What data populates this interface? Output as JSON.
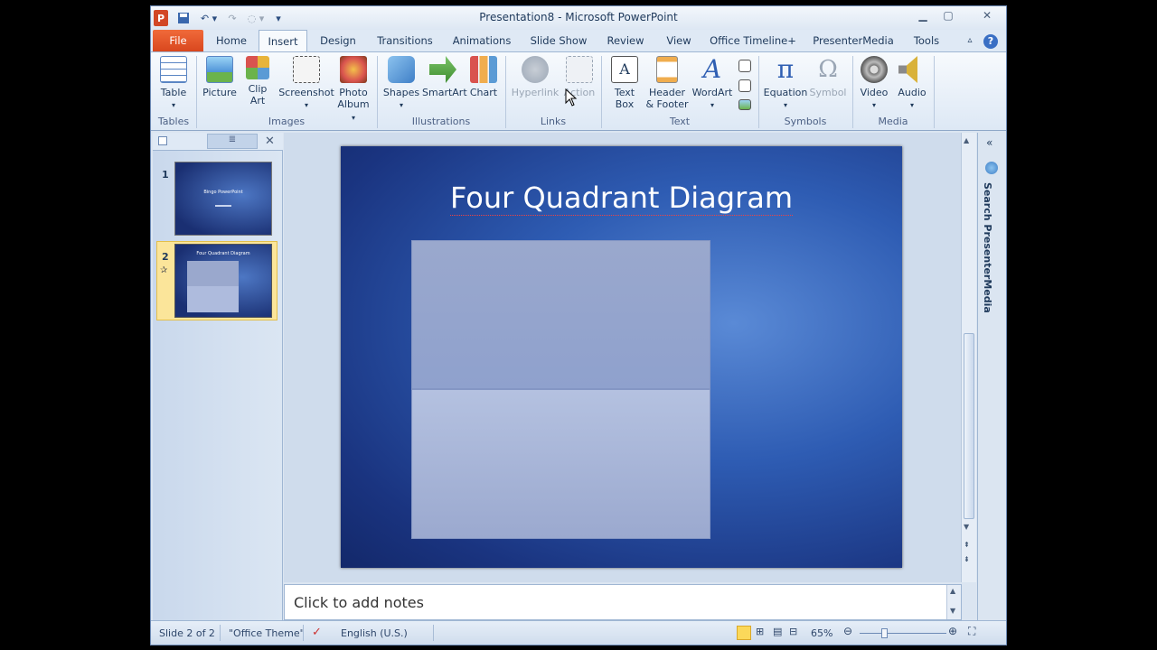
{
  "window": {
    "title": "Presentation8  -  Microsoft PowerPoint"
  },
  "tabs": [
    "File",
    "Home",
    "Insert",
    "Design",
    "Transitions",
    "Animations",
    "Slide Show",
    "Review",
    "View",
    "Office Timeline+",
    "PresenterMedia",
    "Tools"
  ],
  "ribbon": {
    "tables": {
      "table": "Table",
      "group": "Tables"
    },
    "images": {
      "picture": "Picture",
      "clip1": "Clip",
      "clip2": "Art",
      "screenshot": "Screenshot",
      "photo1": "Photo",
      "photo2": "Album",
      "group": "Images"
    },
    "illustrations": {
      "shapes": "Shapes",
      "smartart": "SmartArt",
      "chart": "Chart",
      "group": "Illustrations"
    },
    "links": {
      "hyperlink": "Hyperlink",
      "action": "Action",
      "group": "Links"
    },
    "text": {
      "textbox1": "Text",
      "textbox2": "Box",
      "header1": "Header",
      "header2": "& Footer",
      "wordart": "WordArt",
      "group": "Text"
    },
    "symbols": {
      "equation": "Equation",
      "symbol": "Symbol",
      "group": "Symbols"
    },
    "media": {
      "video": "Video",
      "audio": "Audio",
      "group": "Media"
    }
  },
  "slides_panel": {
    "slides": [
      {
        "num": "1",
        "title": "Bingo  PowerPoint"
      },
      {
        "num": "2",
        "title": "Four  Quadrant  Diagram"
      }
    ]
  },
  "slide": {
    "title": "Four Quadrant Diagram"
  },
  "notes": {
    "placeholder": "Click to add notes"
  },
  "right_pane": {
    "label": "Search PresenterMedia"
  },
  "status": {
    "slide": "Slide 2 of 2",
    "theme": "\"Office Theme\"",
    "language": "English (U.S.)",
    "zoom": "65%"
  }
}
